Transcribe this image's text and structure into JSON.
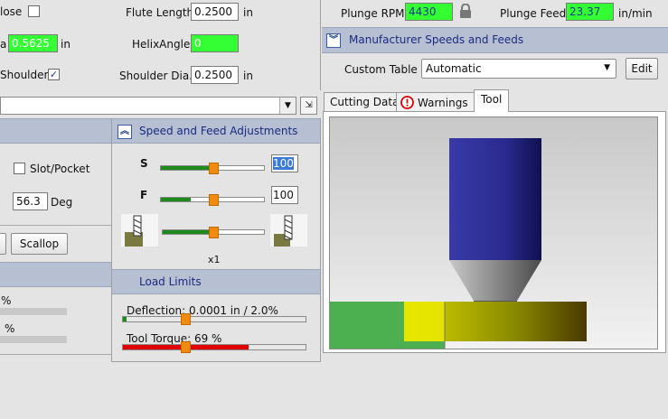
{
  "top_left": {
    "close_label": "lose",
    "flute_length_label": "Flute Length",
    "flute_length_value": "0.2500",
    "flute_length_unit": "in",
    "dia_label": "a",
    "dia_value": "0.5625",
    "dia_unit": "in",
    "helix_angle_label": "HelixAngle",
    "helix_angle_value": "0",
    "shoulder_label": "Shoulder",
    "shoulder_dia_label": "Shoulder Dia.",
    "shoulder_dia_value": "0.2500",
    "shoulder_dia_unit": "in"
  },
  "top_right": {
    "plunge_rpm_label": "Plunge RPM",
    "plunge_rpm_value": "4430",
    "plunge_feed_label": "Plunge Feed",
    "plunge_feed_value": "23.37",
    "plunge_feed_unit": "in/min"
  },
  "manufacturer": {
    "title": "Manufacturer Speeds and Feeds",
    "custom_table_label": "Custom Table",
    "custom_table_value": "Automatic",
    "edit_label": "Edit"
  },
  "tabs": [
    {
      "label": "Cutting Data"
    },
    {
      "label": "Warnings"
    },
    {
      "label": "Tool"
    }
  ],
  "middle_left": {
    "slot_pocket_label": "Slot/Pocket",
    "angle_value": "56.3",
    "angle_unit": "Deg",
    "scallop_label": "Scallop",
    "pct1": "%",
    "pct2": "%"
  },
  "adjustments": {
    "title": "Speed and Feed Adjustments",
    "s_label": "S",
    "s_value": "100",
    "f_label": "F",
    "f_value": "100",
    "multiplier": "x1"
  },
  "load_limits": {
    "title": "Load Limits",
    "deflection_label": "Deflection: 0.0001 in / 2.0%",
    "deflection_fraction": 0.02,
    "torque_label": "Tool Torque: 69 %",
    "torque_fraction": 0.69
  },
  "colors": {
    "header_bg": "#b6c0d2",
    "green_field": "#33ff33",
    "tool_shank": "#25258a",
    "torque_bar": "#e00000"
  }
}
